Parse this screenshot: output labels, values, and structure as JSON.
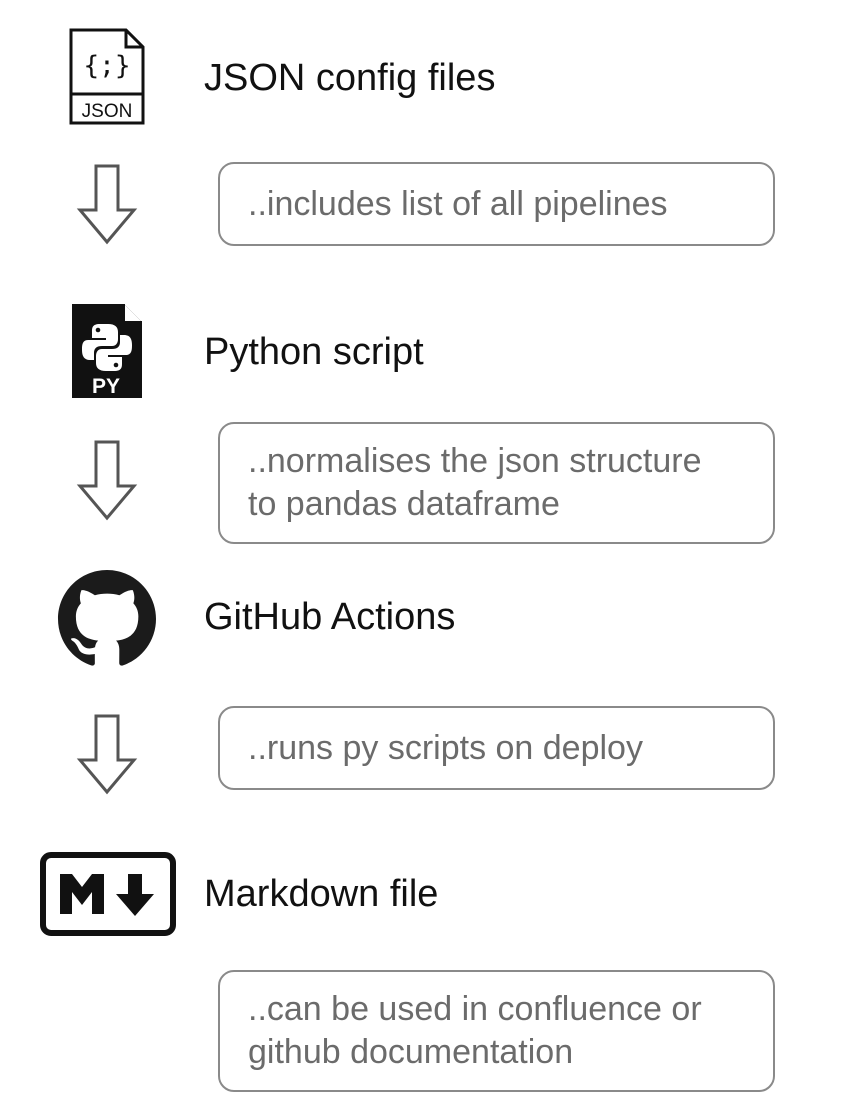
{
  "steps": [
    {
      "label": "JSON config files",
      "icon": "json-file-icon",
      "icon_text": "JSON",
      "icon_glyph": "{;}"
    },
    {
      "label": "Python script",
      "icon": "python-file-icon",
      "icon_text": "PY"
    },
    {
      "label": "GitHub Actions",
      "icon": "github-icon"
    },
    {
      "label": "Markdown file",
      "icon": "markdown-icon"
    }
  ],
  "notes": [
    {
      "text": "..includes list of all pipelines"
    },
    {
      "text": "..normalises the json structure\nto pandas dataframe"
    },
    {
      "text": "..runs py scripts on deploy"
    },
    {
      "text": "..can be used in confluence or\ngithub documentation"
    }
  ],
  "colors": {
    "arrow": "#555555",
    "box_border": "#8a8a8a",
    "note_text": "#6b6b6b",
    "label_text": "#111111"
  }
}
